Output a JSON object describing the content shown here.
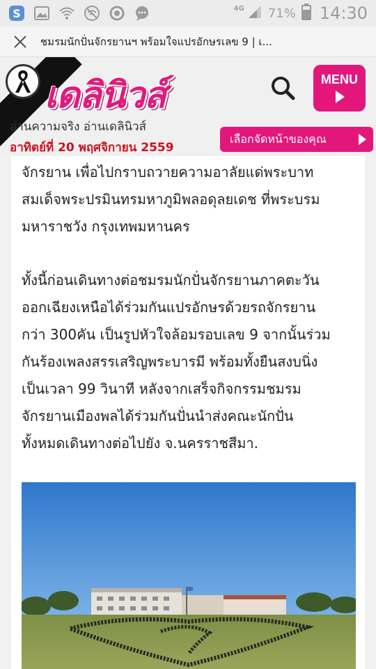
{
  "status_bar": {
    "network": "4G",
    "battery": "71%",
    "time": "14:30",
    "left_icons": [
      "s-app-icon",
      "gallery-icon",
      "wifi-icon",
      "wifi-off-icon",
      "sync-icon",
      "chat-icon"
    ]
  },
  "url_bar": {
    "title": "ชมรมนักปั่นจักรยานฯ พร้อมใจแปรอักษรเลข 9 | เ..."
  },
  "header": {
    "logo_text": "เดลินิวส์",
    "menu_label": "MENU",
    "tagline": "อ่านความจริง อ่านเดลินิวส์",
    "date": "อาทิตย์ที่ 20 พฤศจิกายน 2559",
    "choose_button": "เลือกจัดหน้าของคุณ"
  },
  "article": {
    "paragraph1": [
      "จักรยาน เพื่อไปกราบถวายความอาลัยแด่พระบาท",
      "สมเด็จพระปรมินทรมหาภูมิพลอดุลยเดช ที่พระบรม",
      "มหาราชวัง กรุงเทพมหานคร"
    ],
    "paragraph2": [
      "ทั้งนี้ก่อนเดินทางต่อชมรมนักปั่นจักรยานภาคตะวัน",
      "ออกเฉียงเหนือได้ร่วมกันแปรอักษรด้วยรถจักรยาน",
      "กว่า 300คัน เป็นรูปหัวใจล้อมรอบเลข 9 จากนั้นร่วม",
      "กันร้องเพลงสรรเสริญพระบารมี พร้อมทั้งยืนสงบนิ่ง",
      "เป็นเวลา 99 วินาที หลังจากเสร็จกิจกรรมชมรม",
      "จักรยานเมืองพลได้ร่วมกันปั่นนำส่งคณะนักปั่น",
      "ทั้งหมดเดินทางต่อไปยัง จ.นครราชสีมา."
    ]
  },
  "colors": {
    "brand_pink": "#e3177b",
    "date_red": "#d0121f",
    "status_bar_bg": "#ececec"
  }
}
